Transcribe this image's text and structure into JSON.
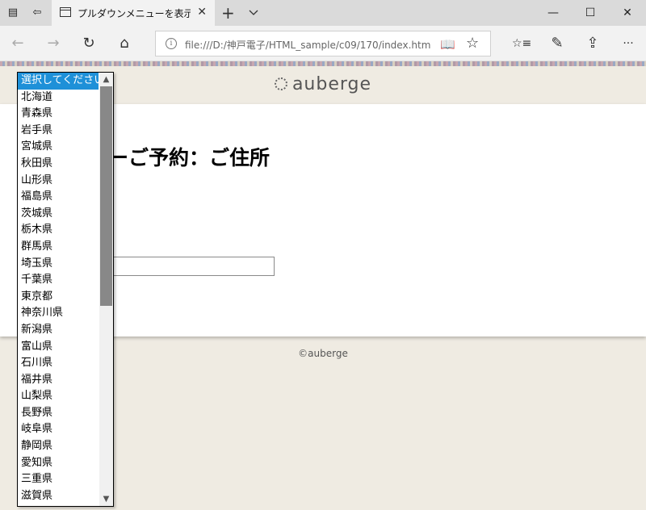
{
  "browser": {
    "tab_title": "プルダウンメニューを表示した",
    "address": "file:///D:/神戸電子/HTML_sample/c09/170/index.htm",
    "glyphs": {
      "tab_set_aside": "▤",
      "tab_back": "⇦",
      "tab_close": "✕",
      "new_tab": "+",
      "minimize": "—",
      "maximize": "☐",
      "window_close": "✕",
      "back": "←",
      "forward": "→",
      "refresh": "↻",
      "home": "⌂",
      "info": "i",
      "reading_view": "📖",
      "favorite": "☆",
      "favorites_hub": "☆≡",
      "notes": "✎",
      "share": "⇪",
      "more": "···"
    }
  },
  "page": {
    "logo": "auberge",
    "heading": "ーご予約：ご住所",
    "footer": "©auberge"
  },
  "dropdown": {
    "scroll_up": "▲",
    "scroll_down": "▼",
    "options": [
      "選択してください",
      "北海道",
      "青森県",
      "岩手県",
      "宮城県",
      "秋田県",
      "山形県",
      "福島県",
      "茨城県",
      "栃木県",
      "群馬県",
      "埼玉県",
      "千葉県",
      "東京都",
      "神奈川県",
      "新潟県",
      "富山県",
      "石川県",
      "福井県",
      "山梨県",
      "長野県",
      "岐阜県",
      "静岡県",
      "愛知県",
      "三重県",
      "滋賀県"
    ]
  },
  "colors": {
    "selected_option": "#1e90d8",
    "page_background": "#efebe2",
    "panel": "#ffffff"
  }
}
